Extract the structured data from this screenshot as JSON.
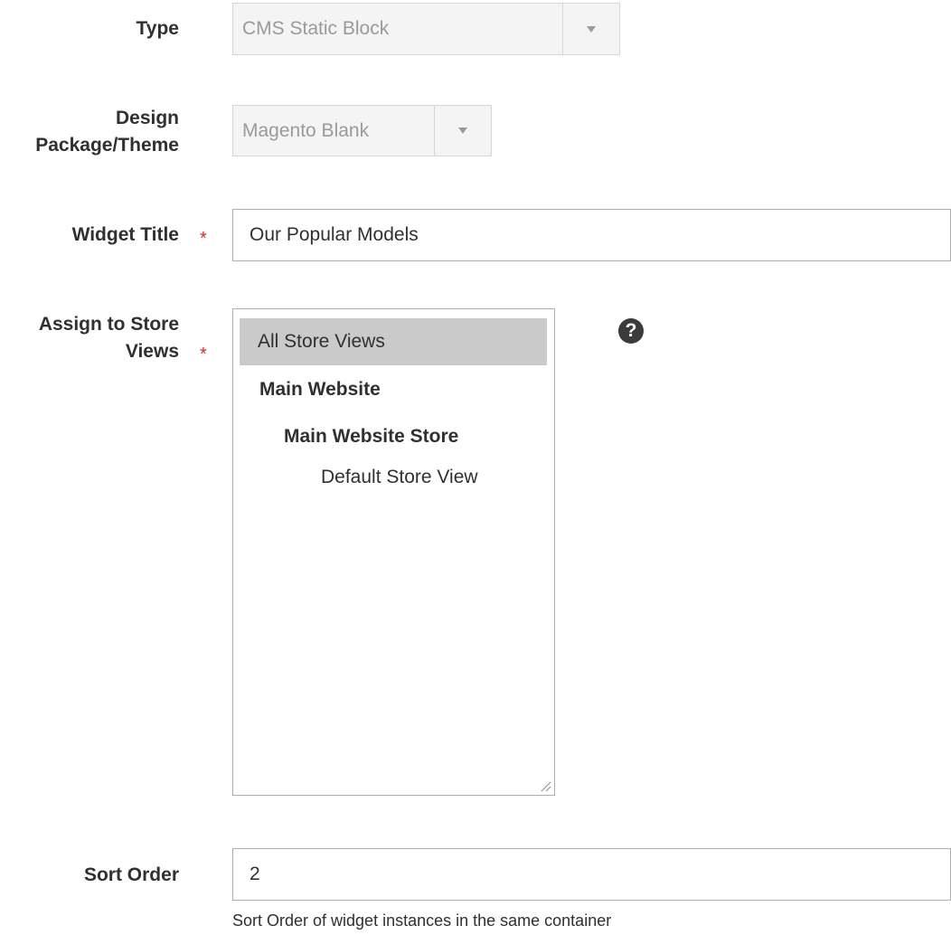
{
  "form": {
    "type": {
      "label": "Type",
      "value": "CMS Static Block"
    },
    "theme": {
      "label_line1": "Design",
      "label_line2": "Package/Theme",
      "value": "Magento Blank"
    },
    "widget_title": {
      "label": "Widget Title",
      "required_mark": "*",
      "value": "Our Popular Models"
    },
    "store_views": {
      "label_line1": "Assign to Store",
      "label_line2": "Views",
      "required_mark": "*",
      "help_glyph": "?",
      "options": [
        {
          "label": "All Store Views",
          "selected": true,
          "bold": false
        },
        {
          "label": "Main Website",
          "selected": false,
          "bold": true
        },
        {
          "label": "Main Website Store",
          "selected": false,
          "bold": true
        },
        {
          "label": "Default Store View",
          "selected": false,
          "bold": false
        }
      ]
    },
    "sort_order": {
      "label": "Sort Order",
      "value": "2",
      "note": "Sort Order of widget instances in the same container"
    }
  },
  "icons": {
    "caret": "chevron-down-icon",
    "help": "question-circle-icon",
    "resize": "resize-grip-icon"
  },
  "colors": {
    "required": "#e22626",
    "selected_option_bg": "#cacaca",
    "disabled_field_bg": "#f4f4f4"
  }
}
